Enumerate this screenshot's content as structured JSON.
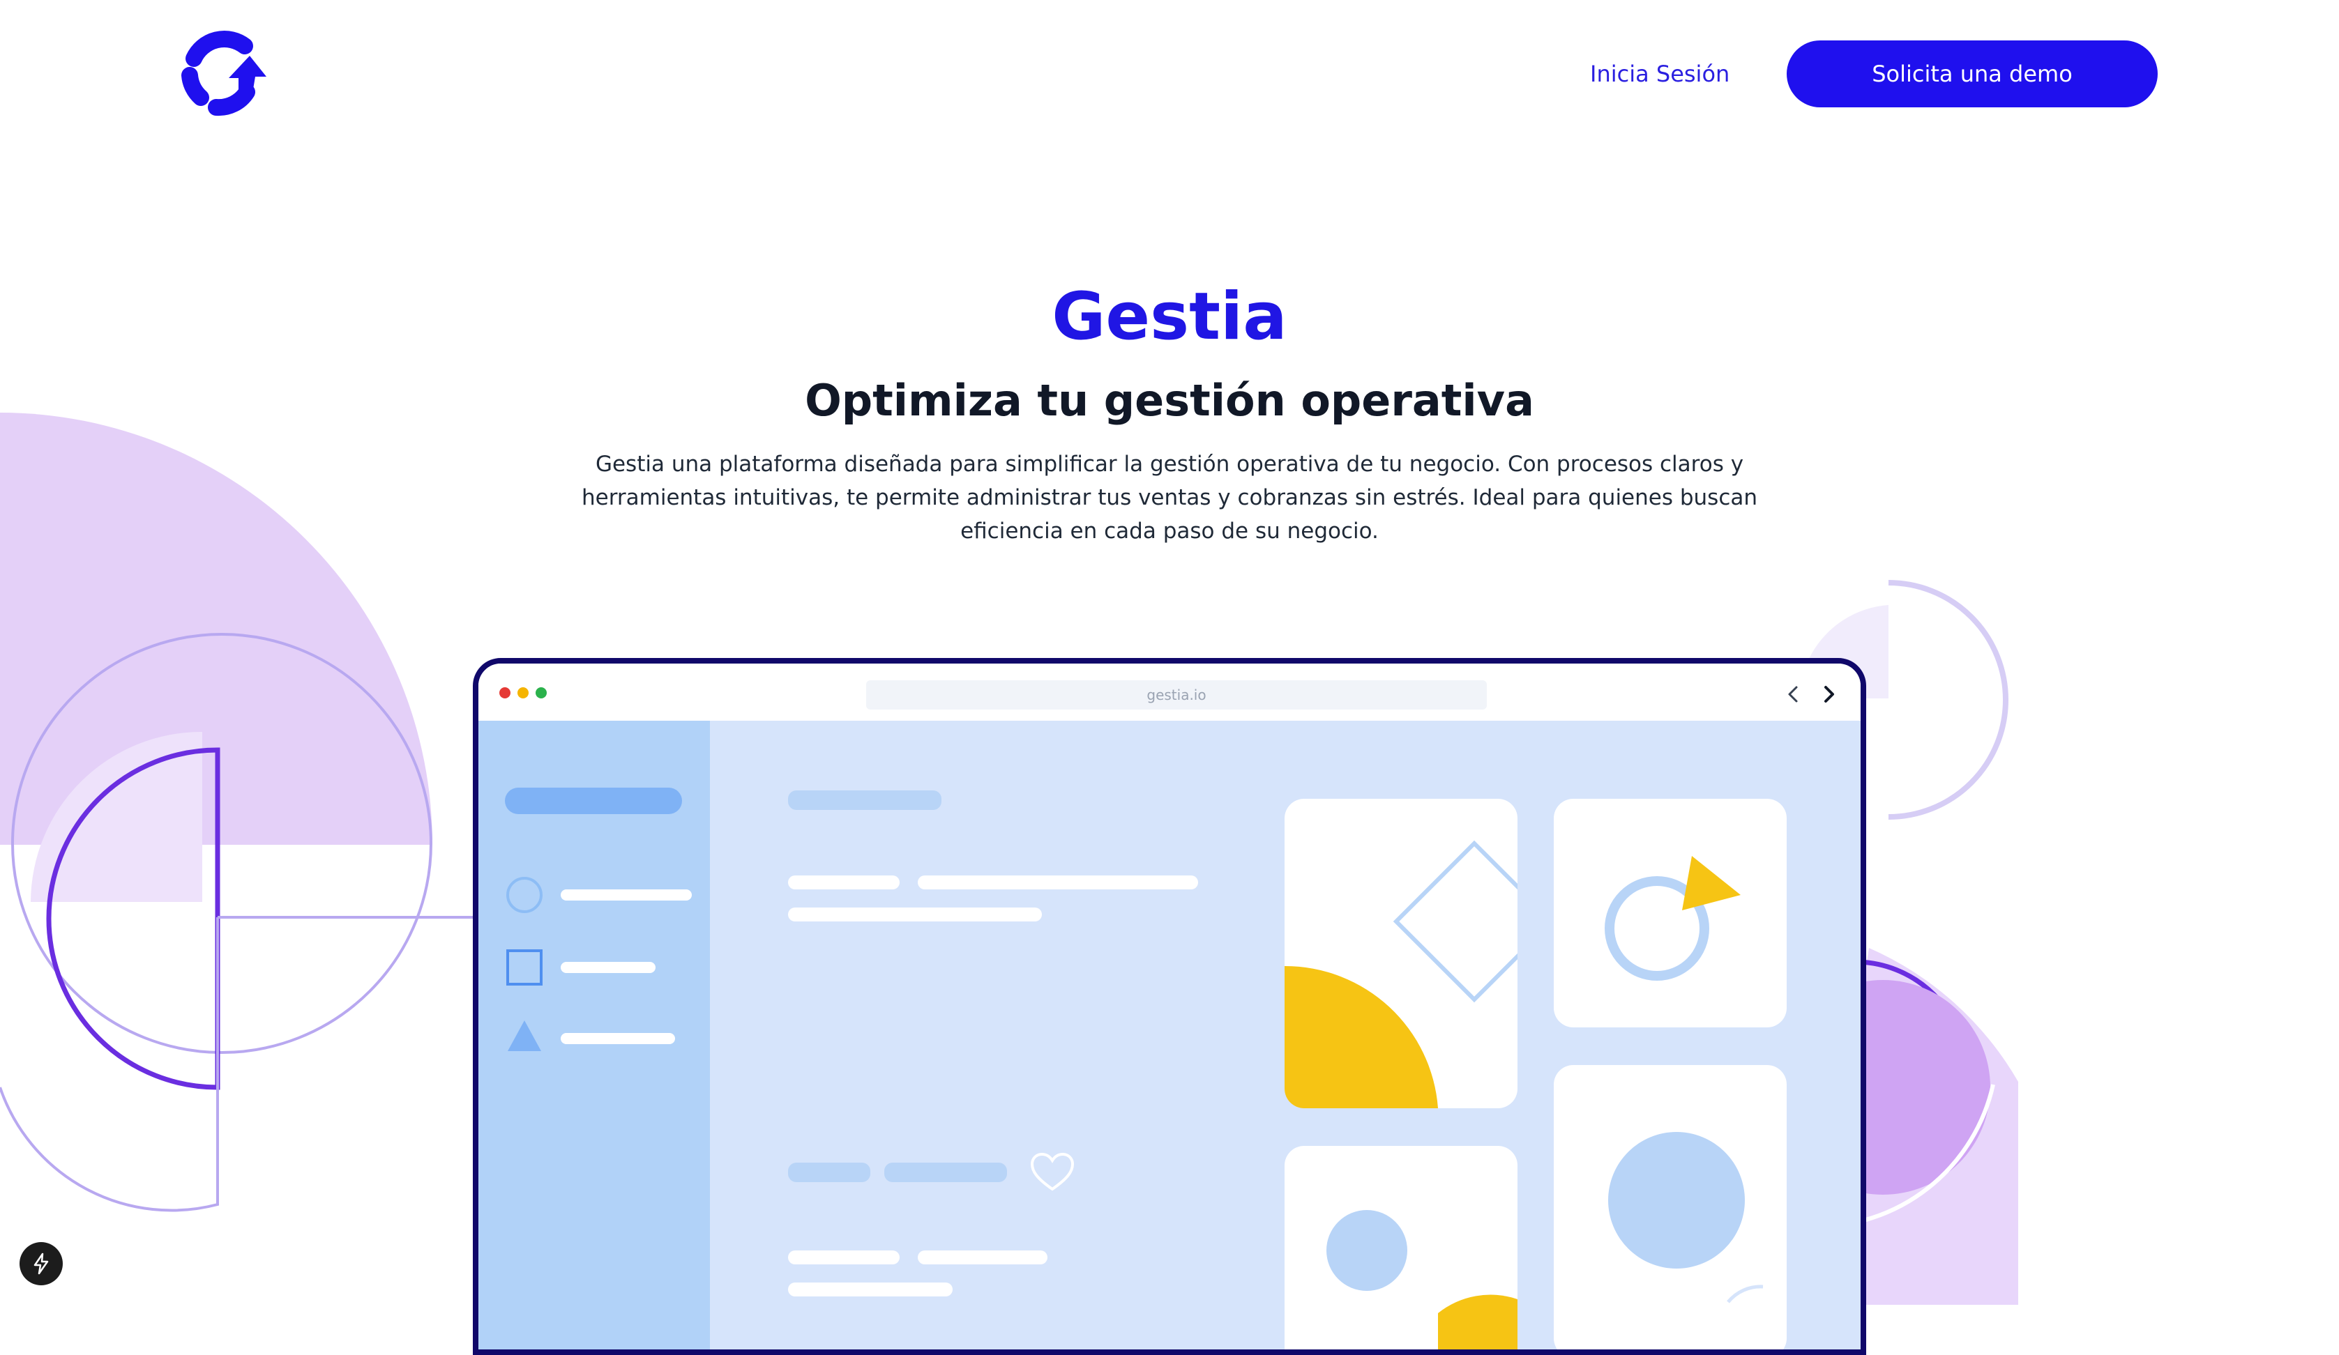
{
  "header": {
    "logo_icon": "gestia-logo-icon",
    "login_label": "Inicia Sesión",
    "demo_label": "Solicita una demo"
  },
  "hero": {
    "title": "Gestia",
    "subtitle": "Optimiza tu gestión operativa",
    "description": "Gestia una plataforma diseñada para simplificar la gestión operativa de tu negocio. Con procesos claros y herramientas intuitivas, te permite administrar tus ventas y cobranzas sin estrés. Ideal para quienes buscan eficiencia en cada paso de su negocio."
  },
  "mockup": {
    "url": "gestia.io",
    "back_icon": "chevron-left-icon",
    "forward_icon": "chevron-right-icon",
    "sidebar_icons": [
      "circle-icon",
      "square-icon",
      "triangle-icon"
    ],
    "heart_icon": "heart-icon"
  },
  "badge": {
    "icon": "lightning-bolt-icon"
  },
  "colors": {
    "brand": "#1f10ee",
    "brand_text": "#2016e4",
    "heading": "#111827",
    "lavender": "#e4d0f8",
    "purple": "#6a2ee0",
    "mock_bg": "#d6e4fb",
    "mock_sidebar": "#b1d2f8",
    "yellow": "#f6c414"
  }
}
